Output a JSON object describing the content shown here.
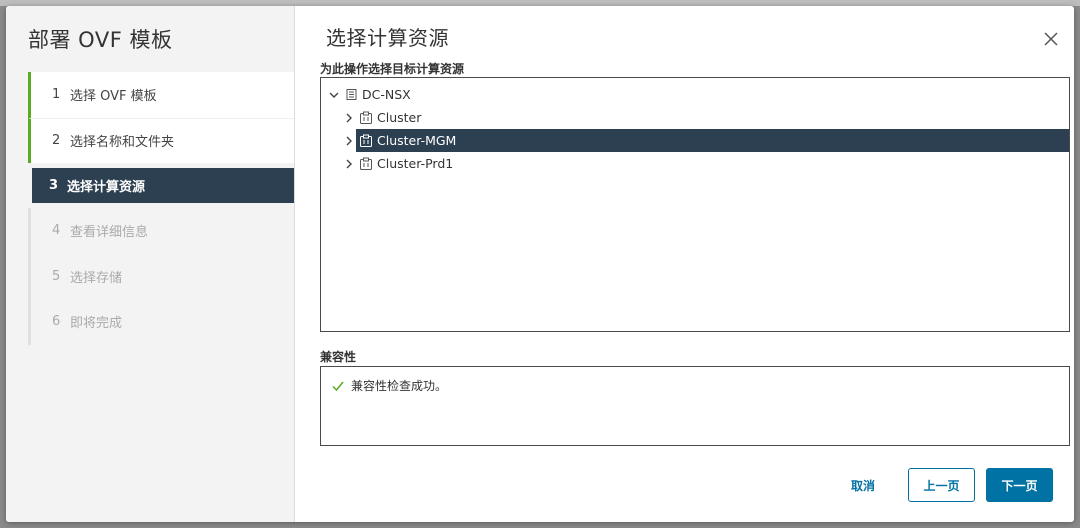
{
  "wizard": {
    "title": "部署 OVF 模板",
    "steps": [
      {
        "num": "1",
        "label": "选择 OVF 模板",
        "state": "done"
      },
      {
        "num": "2",
        "label": "选择名称和文件夹",
        "state": "done"
      },
      {
        "num": "3",
        "label": "选择计算资源",
        "state": "active"
      },
      {
        "num": "4",
        "label": "查看详细信息",
        "state": "pending"
      },
      {
        "num": "5",
        "label": "选择存储",
        "state": "pending"
      },
      {
        "num": "6",
        "label": "即将完成",
        "state": "pending"
      }
    ]
  },
  "page": {
    "title": "选择计算资源",
    "close_icon": "close-icon"
  },
  "tree": {
    "label": "为此操作选择目标计算资源",
    "root": {
      "label": "DC-NSX",
      "icon": "datacenter-icon",
      "expanded": true
    },
    "children": [
      {
        "label": "Cluster",
        "icon": "cluster-icon",
        "selected": false
      },
      {
        "label": "Cluster-MGM",
        "icon": "cluster-icon",
        "selected": true
      },
      {
        "label": "Cluster-Prd1",
        "icon": "cluster-icon",
        "selected": false
      }
    ]
  },
  "compatibility": {
    "label": "兼容性",
    "message": "兼容性检查成功。",
    "icon": "check-icon"
  },
  "footer": {
    "cancel_label": "取消",
    "back_label": "上一页",
    "next_label": "下一页"
  },
  "colors": {
    "accent": "#0072a3",
    "selected_bg": "#2d4051",
    "done_bar": "#5aaa22",
    "success": "#5aaa22"
  }
}
